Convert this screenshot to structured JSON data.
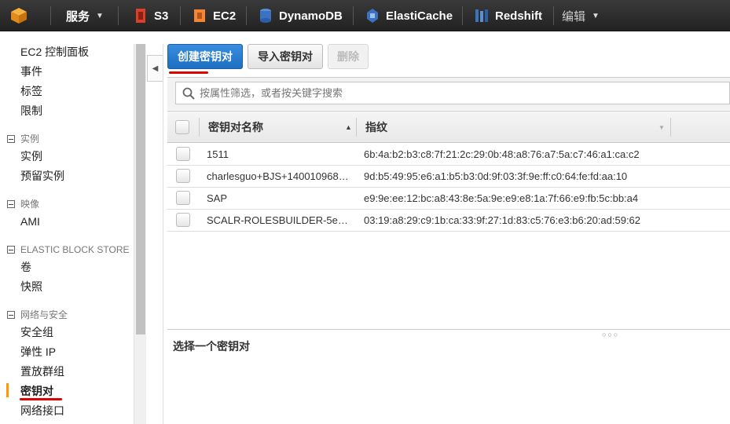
{
  "topbar": {
    "services_label": "服务",
    "services": [
      {
        "label": "S3",
        "icon": "s3-icon",
        "color": "#d9402a"
      },
      {
        "label": "EC2",
        "icon": "ec2-icon",
        "color": "#f58536"
      },
      {
        "label": "DynamoDB",
        "icon": "dynamodb-icon",
        "color": "#3b73c0"
      },
      {
        "label": "ElastiCache",
        "icon": "elasticache-icon",
        "color": "#3b73c0"
      },
      {
        "label": "Redshift",
        "icon": "redshift-icon",
        "color": "#3b73c0"
      }
    ],
    "edit_label": "编辑"
  },
  "sidebar": {
    "top_items": [
      "EC2 控制面板",
      "事件",
      "标签",
      "限制"
    ],
    "sections": [
      {
        "title": "实例",
        "items": [
          "实例",
          "预留实例"
        ]
      },
      {
        "title": "映像",
        "items": [
          "AMI"
        ]
      },
      {
        "title": "ELASTIC BLOCK STORE",
        "items": [
          "卷",
          "快照"
        ]
      },
      {
        "title": "网络与安全",
        "items": [
          "安全组",
          "弹性 IP",
          "置放群组",
          "密钥对",
          "网络接口"
        ]
      }
    ],
    "active_item": "密钥对"
  },
  "toolbar": {
    "create_label": "创建密钥对",
    "import_label": "导入密钥对",
    "delete_label": "删除"
  },
  "search": {
    "placeholder": "按属性筛选，或者按关键字搜索"
  },
  "table": {
    "columns": [
      "密钥对名称",
      "指纹"
    ],
    "rows": [
      {
        "name": "1511",
        "fingerprint": "6b:4a:b2:b3:c8:7f:21:2c:29:0b:48:a8:76:a7:5a:c7:46:a1:ca:c2"
      },
      {
        "name": "charlesguo+BJS+140010968…",
        "fingerprint": "9d:b5:49:95:e6:a1:b5:b3:0d:9f:03:3f:9e:ff:c0:64:fe:fd:aa:10"
      },
      {
        "name": "SAP",
        "fingerprint": "e9:9e:ee:12:bc:a8:43:8e:5a:9e:e9:e8:1a:7f:66:e9:fb:5c:bb:a4"
      },
      {
        "name": "SCALR-ROLESBUILDER-5e…",
        "fingerprint": "03:19:a8:29:c9:1b:ca:33:9f:27:1d:83:c5:76:e3:b6:20:ad:59:62"
      }
    ]
  },
  "detail": {
    "title": "选择一个密钥对"
  }
}
